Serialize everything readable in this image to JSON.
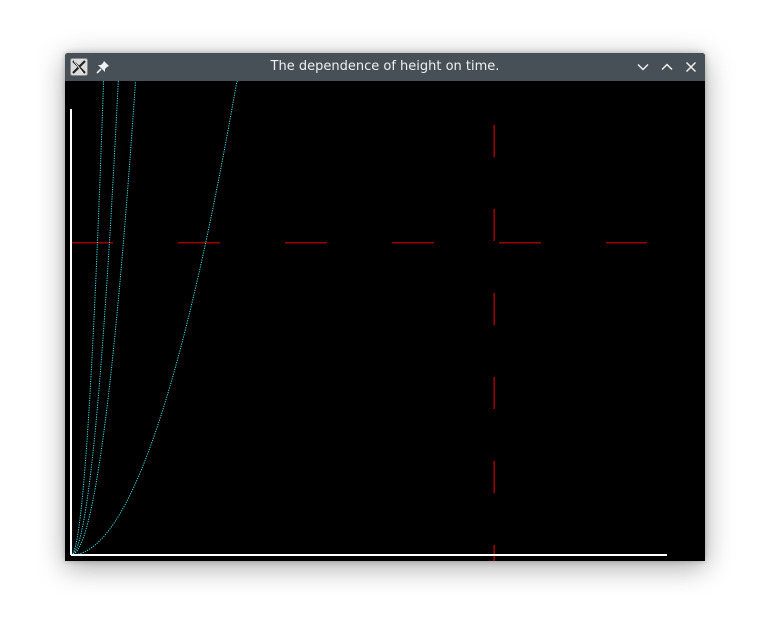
{
  "window": {
    "title": "The dependence of height on time.",
    "icons": {
      "app": "x11-app-icon",
      "pin": "pin-icon",
      "minimize": "chevron-down-icon",
      "maximize": "chevron-up-icon",
      "close": "close-icon"
    }
  },
  "colors": {
    "titlebar_bg": "#475057",
    "title_text": "#eff0f1",
    "canvas_bg": "#000000",
    "axis": "#ffffff",
    "reference_lines": "#cc0000",
    "curve": "#40e0e8"
  },
  "chart_data": {
    "type": "line",
    "title": "",
    "xlabel": "",
    "ylabel": "",
    "xlim": [
      0,
      1
    ],
    "ylim": [
      0,
      1
    ],
    "grid": false,
    "legend": "none",
    "reference_lines": {
      "style": "dashed",
      "horizontal_y": 0.7,
      "vertical_x": 0.71
    },
    "series": [
      {
        "values_kind": "power",
        "exponent": 2,
        "scale": 0.27
      },
      {
        "values_kind": "power",
        "exponent": 2,
        "scale": 0.105
      },
      {
        "values_kind": "power",
        "exponent": 2,
        "scale": 0.077
      },
      {
        "values_kind": "power",
        "exponent": 2,
        "scale": 0.053
      }
    ]
  }
}
